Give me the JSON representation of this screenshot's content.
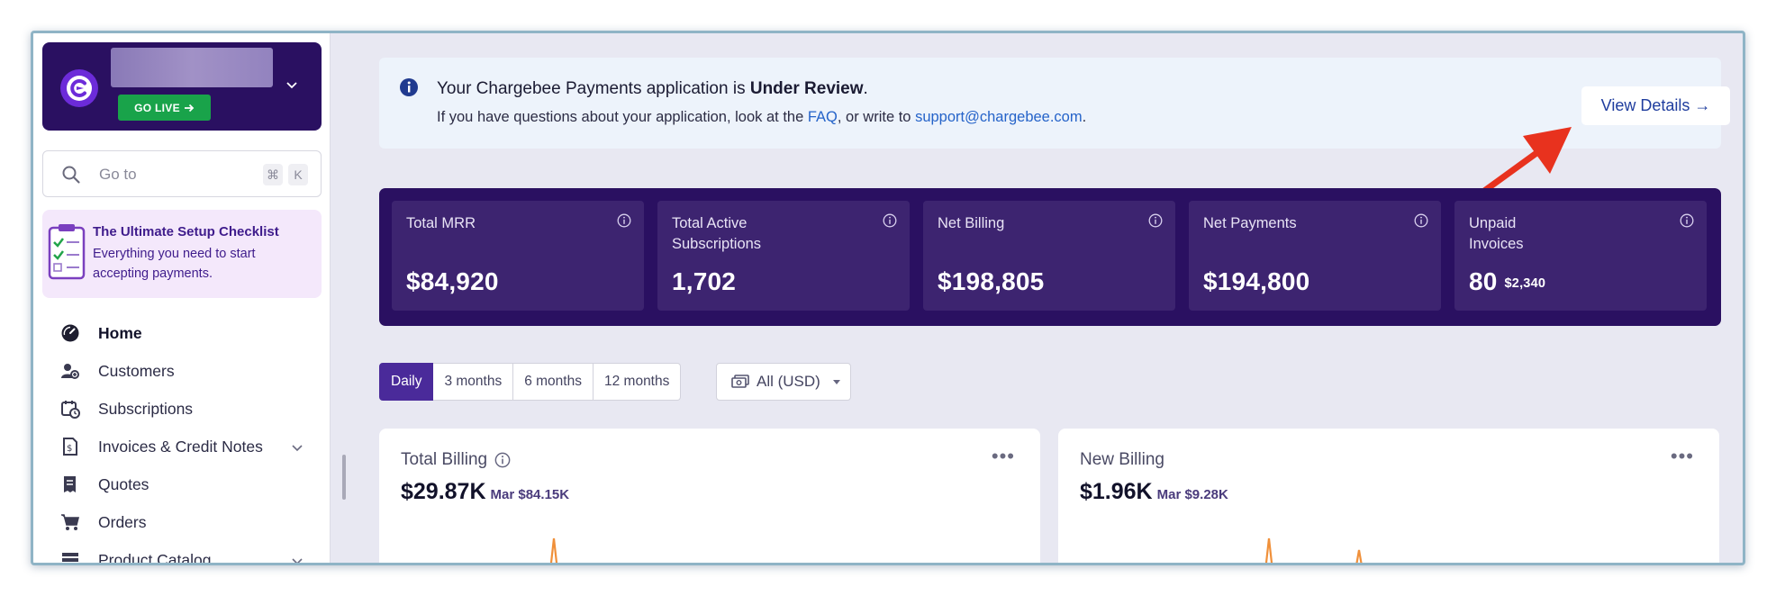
{
  "account": {
    "go_live_label": "GO LIVE"
  },
  "search": {
    "placeholder": "Go to",
    "shortcut_cmd": "⌘",
    "shortcut_key": "K"
  },
  "checklist": {
    "title": "The Ultimate Setup Checklist",
    "subtitle": "Everything you need to start accepting payments."
  },
  "nav": {
    "items": [
      {
        "label": "Home",
        "icon": "dashboard-icon",
        "active": true
      },
      {
        "label": "Customers",
        "icon": "users-icon"
      },
      {
        "label": "Subscriptions",
        "icon": "calendar-clock-icon"
      },
      {
        "label": "Invoices & Credit Notes",
        "icon": "invoice-icon",
        "expandable": true
      },
      {
        "label": "Quotes",
        "icon": "quote-icon"
      },
      {
        "label": "Orders",
        "icon": "cart-icon"
      },
      {
        "label": "Product Catalog",
        "icon": "catalog-icon",
        "expandable": true
      }
    ]
  },
  "banner": {
    "title_prefix": "Your Chargebee Payments application is ",
    "title_status": "Under Review",
    "title_suffix": ".",
    "sub_prefix": "If you have questions about your application, look at the ",
    "faq_link": "FAQ",
    "sub_middle": ", or write to ",
    "email_link": "support@chargebee.com",
    "sub_suffix": ".",
    "view_details_label": "View Details →"
  },
  "kpis": [
    {
      "label": "Total MRR",
      "value": "$84,920"
    },
    {
      "label": "Total Active Subscriptions",
      "value": "1,702"
    },
    {
      "label": "Net Billing",
      "value": "$198,805"
    },
    {
      "label": "Net Payments",
      "value": "$194,800"
    },
    {
      "label": "Unpaid Invoices",
      "value": "80",
      "sub": "$2,340"
    }
  ],
  "filters": {
    "ranges": [
      "Daily",
      "3 months",
      "6 months",
      "12 months"
    ],
    "active_range": "Daily",
    "currency": "All (USD)"
  },
  "cards": [
    {
      "title": "Total Billing",
      "value": "$29.87K",
      "prev": "Mar $84.15K"
    },
    {
      "title": "New Billing",
      "value": "$1.96K",
      "prev": "Mar $9.28K"
    }
  ],
  "colors": {
    "brand_dark": "#2a1061",
    "kpi_tile": "#3d2470",
    "accent_purple": "#4a2a9a",
    "go_live_green": "#19a34a",
    "link_blue": "#2563c9",
    "annotation_red": "#e8321e",
    "spark_orange": "#f0903a"
  }
}
